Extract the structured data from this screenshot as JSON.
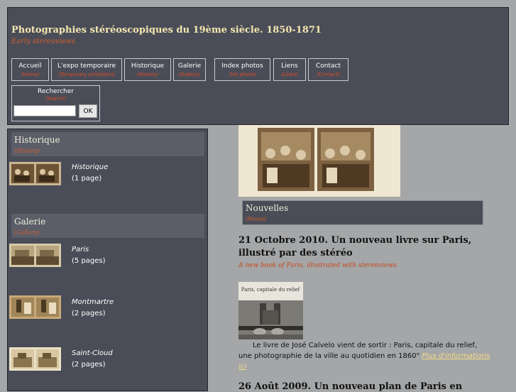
{
  "header": {
    "title": "Photographies stéréoscopiques du 19ème siècle. 1850-1871",
    "subtitle": "Early stereoviews"
  },
  "nav": [
    {
      "label": "Accueil",
      "sub": "(Home)"
    },
    {
      "label": "L'expo temporaire",
      "sub": "(Temporary exhibition)"
    },
    {
      "label": "Historique",
      "sub": "(History)"
    },
    {
      "label": "Galerie",
      "sub": "(Gallery)"
    },
    {
      "label": "Index photos",
      "sub": "(list photo)"
    },
    {
      "label": "Liens",
      "sub": "(Links)"
    },
    {
      "label": "Contact",
      "sub": "(Contact)"
    }
  ],
  "search": {
    "label": "Rechercher",
    "sub": "(Search)",
    "value": "",
    "button": "OK"
  },
  "sidebar": {
    "historique": {
      "title": "Historique",
      "sub": "(History)",
      "items": [
        {
          "name": "Historique",
          "count": "(1 page)"
        }
      ]
    },
    "galerie": {
      "title": "Galerie",
      "sub": "(Gallery)",
      "items": [
        {
          "name": "Paris",
          "count": "(5 pages)"
        },
        {
          "name": "Montmartre",
          "count": "(2 pages)"
        },
        {
          "name": "Saint-Cloud",
          "count": "(2 pages)"
        }
      ]
    }
  },
  "news": {
    "title": "Nouvelles",
    "sub": "(News)",
    "article1": {
      "title": "21 Octobre 2010. Un nouveau livre sur Paris, illustré par des stéréo",
      "sub": "A new book of Paris, illustrated with stereoviews",
      "body": "Le livre de José Calvelo vient de sortir : Paris, capitale du relief, une photographie de la ville au quotidien en 1860\"",
      "more": "Plus d'informations ici",
      "book_cover_text": "Paris, capitale du relief"
    },
    "article2": {
      "title": "26 Août 2009. Un nouveau plan de Paris en"
    }
  },
  "colors": {
    "background": "#a4a6a8",
    "panel": "#4a4d57",
    "accent": "#d35d2c",
    "title": "#f4e6b0"
  }
}
